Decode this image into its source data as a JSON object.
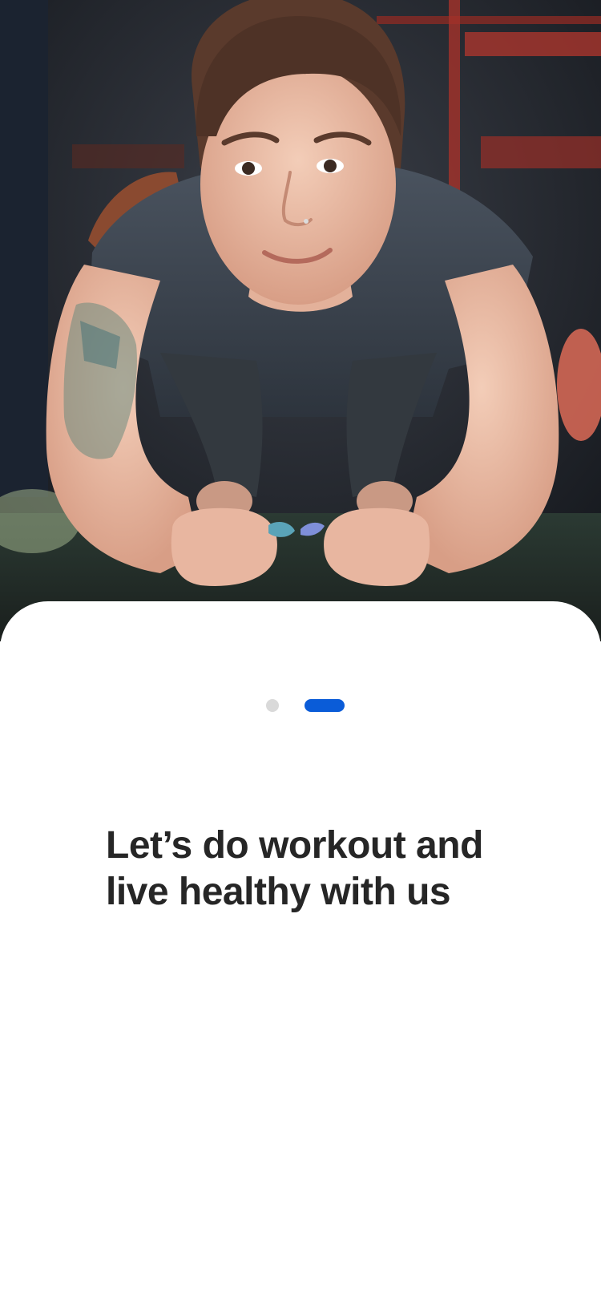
{
  "onboarding": {
    "hero_image": {
      "subject": "woman holding plank in gym"
    },
    "pager": {
      "total": 2,
      "active_index": 2,
      "active_color": "#0A5CD8",
      "inactive_color": "#D9D9D9"
    },
    "headline": {
      "line1": "Let’s do workout and",
      "line2": "live healthy with us"
    }
  }
}
